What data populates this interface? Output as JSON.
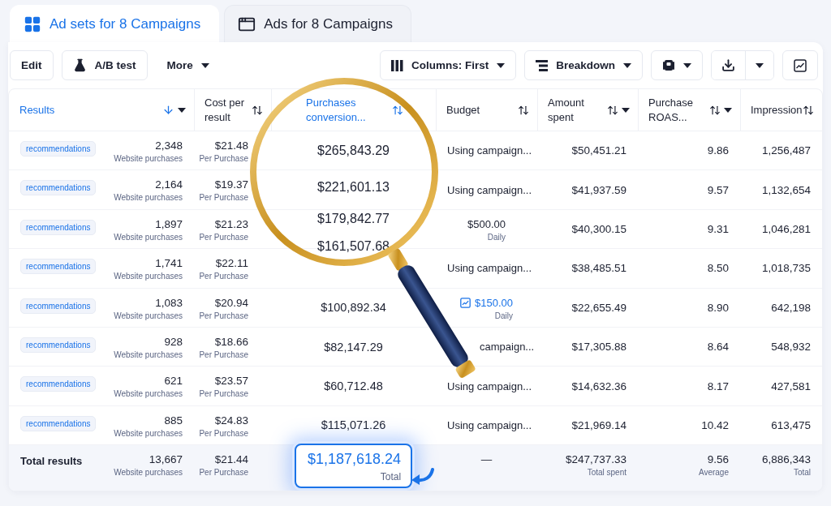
{
  "tabs": [
    {
      "label": "Ad sets for 8 Campaigns",
      "selected": true
    },
    {
      "label": "Ads for 8 Campaigns",
      "selected": false
    }
  ],
  "toolbar": [
    {
      "kind": "button",
      "label": "Edit"
    },
    {
      "kind": "flask",
      "label": "A/B test"
    },
    {
      "kind": "menu",
      "label": "More"
    },
    {
      "kind": "spacer"
    },
    {
      "kind": "columns",
      "label": "Columns: First"
    },
    {
      "kind": "breakdown",
      "label": "Breakdown"
    },
    {
      "kind": "cards"
    },
    {
      "kind": "download"
    },
    {
      "kind": "chart"
    }
  ],
  "columns": [
    {
      "label": "Results",
      "dropdown": true,
      "selected": true
    },
    {
      "label": "Cost per result",
      "dropdown": false,
      "selected": false
    },
    {
      "label": "Purchases conversion...",
      "dropdown": false,
      "selected": true
    },
    {
      "label": "Budget",
      "dropdown": false,
      "selected": false
    },
    {
      "label": "Amount spent",
      "dropdown": true,
      "selected": false
    },
    {
      "label": "Purchase ROAS...",
      "dropdown": true,
      "selected": false
    },
    {
      "label": "Impression",
      "dropdown": false,
      "selected": false
    }
  ],
  "rows": [
    {
      "tag": "recommendations",
      "results": "2,348",
      "results_label": "Website purchases",
      "cost": "$21.48",
      "cost_label": "Per Purchase",
      "purchases": "$265,843.29",
      "magnified": true,
      "budget": {
        "kind": "campaign",
        "value": "Using campaign..."
      },
      "amount": "$50,451.21",
      "roas": "9.86",
      "impressions": "1,256,487"
    },
    {
      "tag": "recommendations",
      "results": "2,164",
      "results_label": "Website purchases",
      "cost": "$19.37",
      "cost_label": "Per Purchase",
      "purchases": "$221,601.13",
      "magnified": true,
      "budget": {
        "kind": "campaign",
        "value": "Using campaign..."
      },
      "amount": "$41,937.59",
      "roas": "9.57",
      "impressions": "1,132,654"
    },
    {
      "tag": "recommendations",
      "results": "1,897",
      "results_label": "Website purchases",
      "cost": "$21.23",
      "cost_label": "Per Purchase",
      "purchases": "$179,842.77",
      "magnified": true,
      "budget": {
        "kind": "daily",
        "value": "$500.00",
        "period": "Daily",
        "edited": false
      },
      "amount": "$40,300.15",
      "roas": "9.31",
      "impressions": "1,046,281"
    },
    {
      "tag": "recommendations",
      "results": "1,741",
      "results_label": "Website purchases",
      "cost": "$22.11",
      "cost_label": "Per Purchase",
      "purchases": "$161,507.68",
      "magnified": true,
      "budget": {
        "kind": "campaign",
        "value": "Using campaign..."
      },
      "amount": "$38,485.51",
      "roas": "8.50",
      "impressions": "1,018,735"
    },
    {
      "tag": "recommendations",
      "results": "1,083",
      "results_label": "Website purchases",
      "cost": "$20.94",
      "cost_label": "Per Purchase",
      "purchases": "$100,892.34",
      "magnified": false,
      "budget": {
        "kind": "daily",
        "value": "$150.00",
        "period": "Daily",
        "edited": true
      },
      "amount": "$22,655.49",
      "roas": "8.90",
      "impressions": "642,198"
    },
    {
      "tag": "recommendations",
      "results": "928",
      "results_label": "Website purchases",
      "cost": "$18.66",
      "cost_label": "Per Purchase",
      "purchases": "$82,147.29",
      "magnified": false,
      "budget": {
        "kind": "covered",
        "value": "campaign..."
      },
      "amount": "$17,305.88",
      "roas": "8.64",
      "impressions": "548,932"
    },
    {
      "tag": "recommendations",
      "results": "621",
      "results_label": "Website purchases",
      "cost": "$23.57",
      "cost_label": "Per Purchase",
      "purchases": "$60,712.48",
      "magnified": false,
      "budget": {
        "kind": "campaign",
        "value": "Using campaign..."
      },
      "amount": "$14,632.36",
      "roas": "8.17",
      "impressions": "427,581"
    },
    {
      "tag": "recommendations",
      "results": "885",
      "results_label": "Website purchases",
      "cost": "$24.83",
      "cost_label": "Per Purchase",
      "purchases": "$115,071.26",
      "magnified": false,
      "budget": {
        "kind": "campaign",
        "value": "Using campaign..."
      },
      "amount": "$21,969.14",
      "roas": "10.42",
      "impressions": "613,475"
    }
  ],
  "totals": {
    "label": "Total results",
    "results": "13,667",
    "results_label": "Website purchases",
    "cost": "$21.44",
    "cost_label": "Per Purchase",
    "purchases": "$1,187,618.24",
    "purchases_label": "Total",
    "budget": "—",
    "amount": "$247,737.33",
    "amount_label": "Total spent",
    "roas": "9.56",
    "roas_label": "Average",
    "impressions": "6,886,343",
    "impressions_label": "Total"
  }
}
